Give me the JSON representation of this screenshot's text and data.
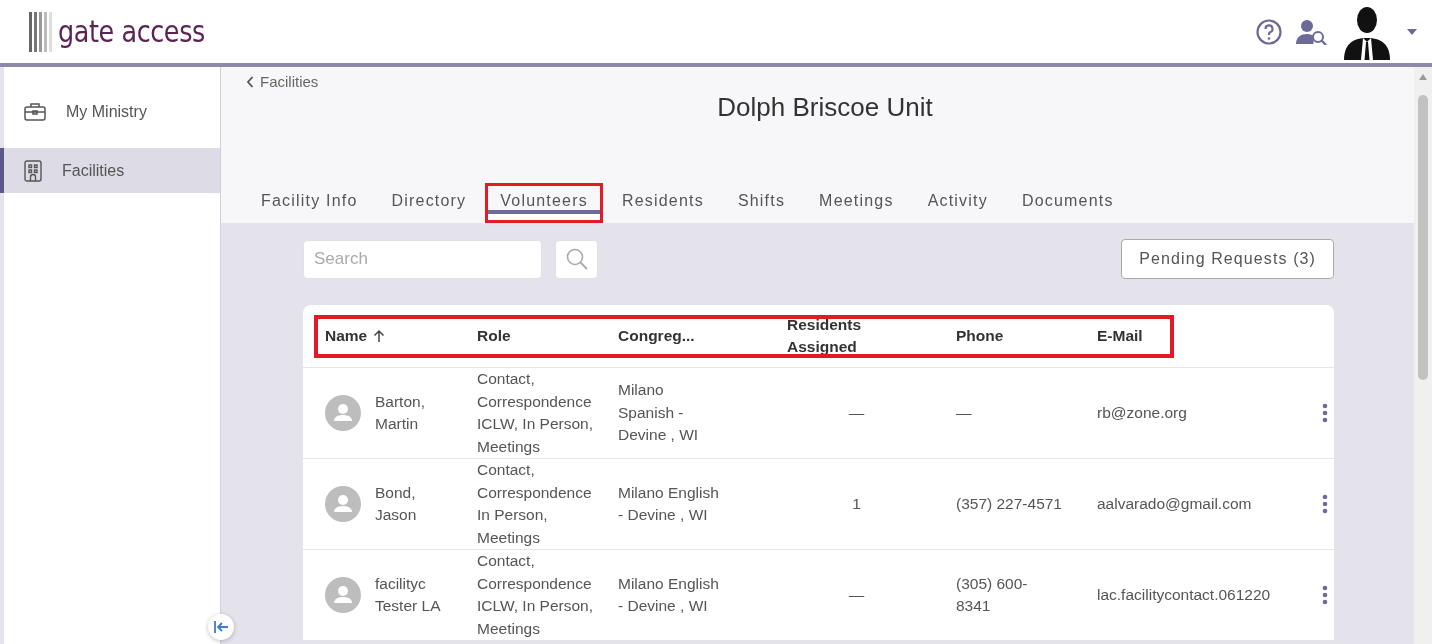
{
  "app": {
    "logo": "gate access"
  },
  "sidebar": {
    "items": [
      {
        "label": "My Ministry",
        "selected": false
      },
      {
        "label": "Facilities",
        "selected": true
      }
    ]
  },
  "breadcrumb": "Facilities",
  "title": "Dolph Briscoe Unit",
  "tabs": [
    {
      "label": "Facility Info",
      "selected": false,
      "highlighted": false
    },
    {
      "label": "Directory",
      "selected": false,
      "highlighted": false
    },
    {
      "label": "Volunteers",
      "selected": true,
      "highlighted": true
    },
    {
      "label": "Residents",
      "selected": false,
      "highlighted": false
    },
    {
      "label": "Shifts",
      "selected": false,
      "highlighted": false
    },
    {
      "label": "Meetings",
      "selected": false,
      "highlighted": false
    },
    {
      "label": "Activity",
      "selected": false,
      "highlighted": false
    },
    {
      "label": "Documents",
      "selected": false,
      "highlighted": false
    }
  ],
  "search": {
    "placeholder": "Search"
  },
  "pending_button": "Pending Requests (3)",
  "table": {
    "header_highlighted": true,
    "columns": [
      {
        "label": "Name",
        "sorted": true
      },
      {
        "label": "Role",
        "sorted": false
      },
      {
        "label": "Congreg...",
        "sorted": false
      },
      {
        "label": "Residents\nAssigned",
        "sorted": false
      },
      {
        "label": "Phone",
        "sorted": false
      },
      {
        "label": "E-Mail",
        "sorted": false
      }
    ],
    "rows": [
      {
        "name": "Barton,\nMartin",
        "role": "Contact,\nCorrespondence\nICLW, In Person,\nMeetings",
        "congregation": "Milano\nSpanish -\nDevine , WI",
        "residents": "—",
        "phone": "—",
        "email": "rb@zone.org"
      },
      {
        "name": "Bond,\nJason",
        "role": "Contact,\nCorrespondence\nIn Person,\nMeetings",
        "congregation": "Milano English\n- Devine , WI",
        "residents": "1",
        "phone": "(357) 227-4571",
        "email": "aalvarado@gmail.com"
      },
      {
        "name": "facilityc\nTester LA",
        "role": "Contact,\nCorrespondence\nICLW, In Person,\nMeetings",
        "congregation": "Milano English\n- Devine , WI",
        "residents": "—",
        "phone": "(305) 600-\n8341",
        "email": "lac.facilitycontact.061220"
      }
    ]
  }
}
